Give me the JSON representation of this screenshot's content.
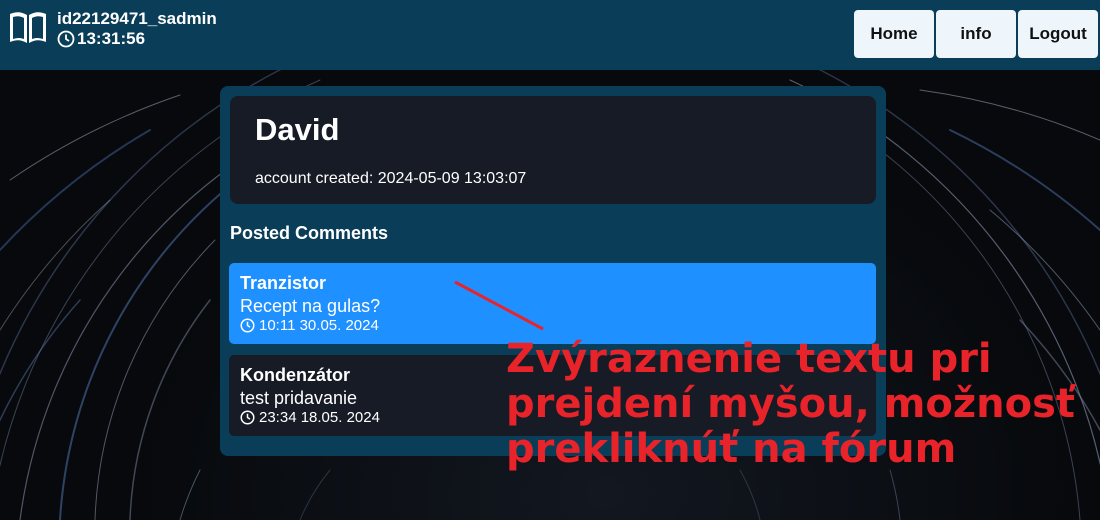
{
  "header": {
    "username": "id22129471_sadmin",
    "time": "13:31:56",
    "logo_icon": "book-icon",
    "nav": [
      {
        "label": "Home"
      },
      {
        "label": "info"
      },
      {
        "label": "Logout"
      }
    ]
  },
  "profile": {
    "name": "David",
    "created": "account created: 2024-05-09 13:03:07"
  },
  "comments_section": {
    "title": "Posted Comments",
    "items": [
      {
        "forum": "Tranzistor",
        "text": "Recept na gulas?",
        "time": "10:11 30.05. 2024",
        "highlighted": true
      },
      {
        "forum": "Kondenzátor",
        "text": "test pridavanie",
        "time": "23:34 18.05. 2024",
        "highlighted": false
      }
    ]
  },
  "annotation": {
    "text": "Zvýraznenie textu pri prejdení myšou, možnosť prekliknúť na fórum",
    "color": "#e8232a"
  },
  "colors": {
    "topbar": "#0a3d57",
    "card": "#161b26",
    "highlight": "#1e90ff"
  }
}
